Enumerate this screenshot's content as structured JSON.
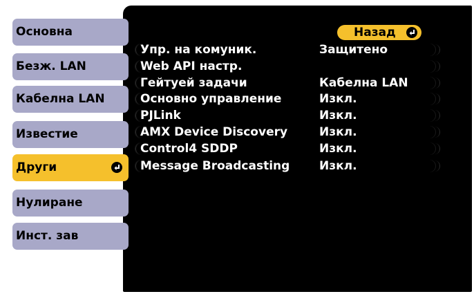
{
  "tabs": [
    {
      "label": "Основна",
      "active": false
    },
    {
      "label": "Безж. LAN",
      "active": false
    },
    {
      "label": "Кабелна LAN",
      "active": false
    },
    {
      "label": "Известие",
      "active": false
    },
    {
      "label": "Други",
      "active": true
    },
    {
      "label": "Нулиране",
      "active": false
    },
    {
      "label": "Инст. зав",
      "active": false
    }
  ],
  "back_label": "Назад",
  "rows": [
    {
      "label": "Упр. на комуник.",
      "value": "Защитено"
    },
    {
      "label": "Web API настр.",
      "value": ""
    },
    {
      "label": "Гейтуей задачи",
      "value": "Кабелна LAN"
    },
    {
      "label": "Основно управление",
      "value": "Изкл."
    },
    {
      "label": "PJLink",
      "value": "Изкл."
    },
    {
      "label": "AMX Device Discovery",
      "value": "Изкл."
    },
    {
      "label": "Control4 SDDP",
      "value": "Изкл."
    },
    {
      "label": "Message Broadcasting",
      "value": "Изкл."
    }
  ],
  "colors": {
    "tab_bg": "#a8a8c8",
    "active_tab_bg": "#f5c02c",
    "panel_bg": "#000000",
    "text_on_panel": "#ffffff"
  }
}
